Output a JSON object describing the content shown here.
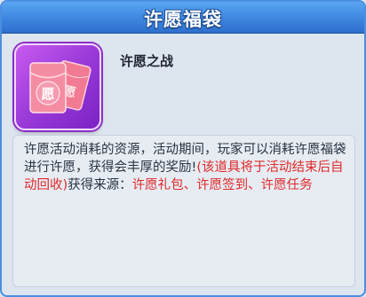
{
  "window": {
    "title": "许愿福袋"
  },
  "item": {
    "name": "许愿之战",
    "icon_glyph": "愿",
    "icon": "red-envelope-icon"
  },
  "description": {
    "normal_1": "许愿活动消耗的资源，活动期间，玩家可以消耗许愿福袋进行许愿，获得会丰厚的奖励!",
    "red_1": "(该道具将于活动结束后自动回收)",
    "normal_2": "获得来源：",
    "red_2": "许愿礼包、许愿签到、许愿任务"
  },
  "colors": {
    "title_bar": "#3e86e0",
    "panel_bg": "#dde5ef",
    "highlight_red": "#e02a2a",
    "icon_bg": "#9a3ad9"
  }
}
